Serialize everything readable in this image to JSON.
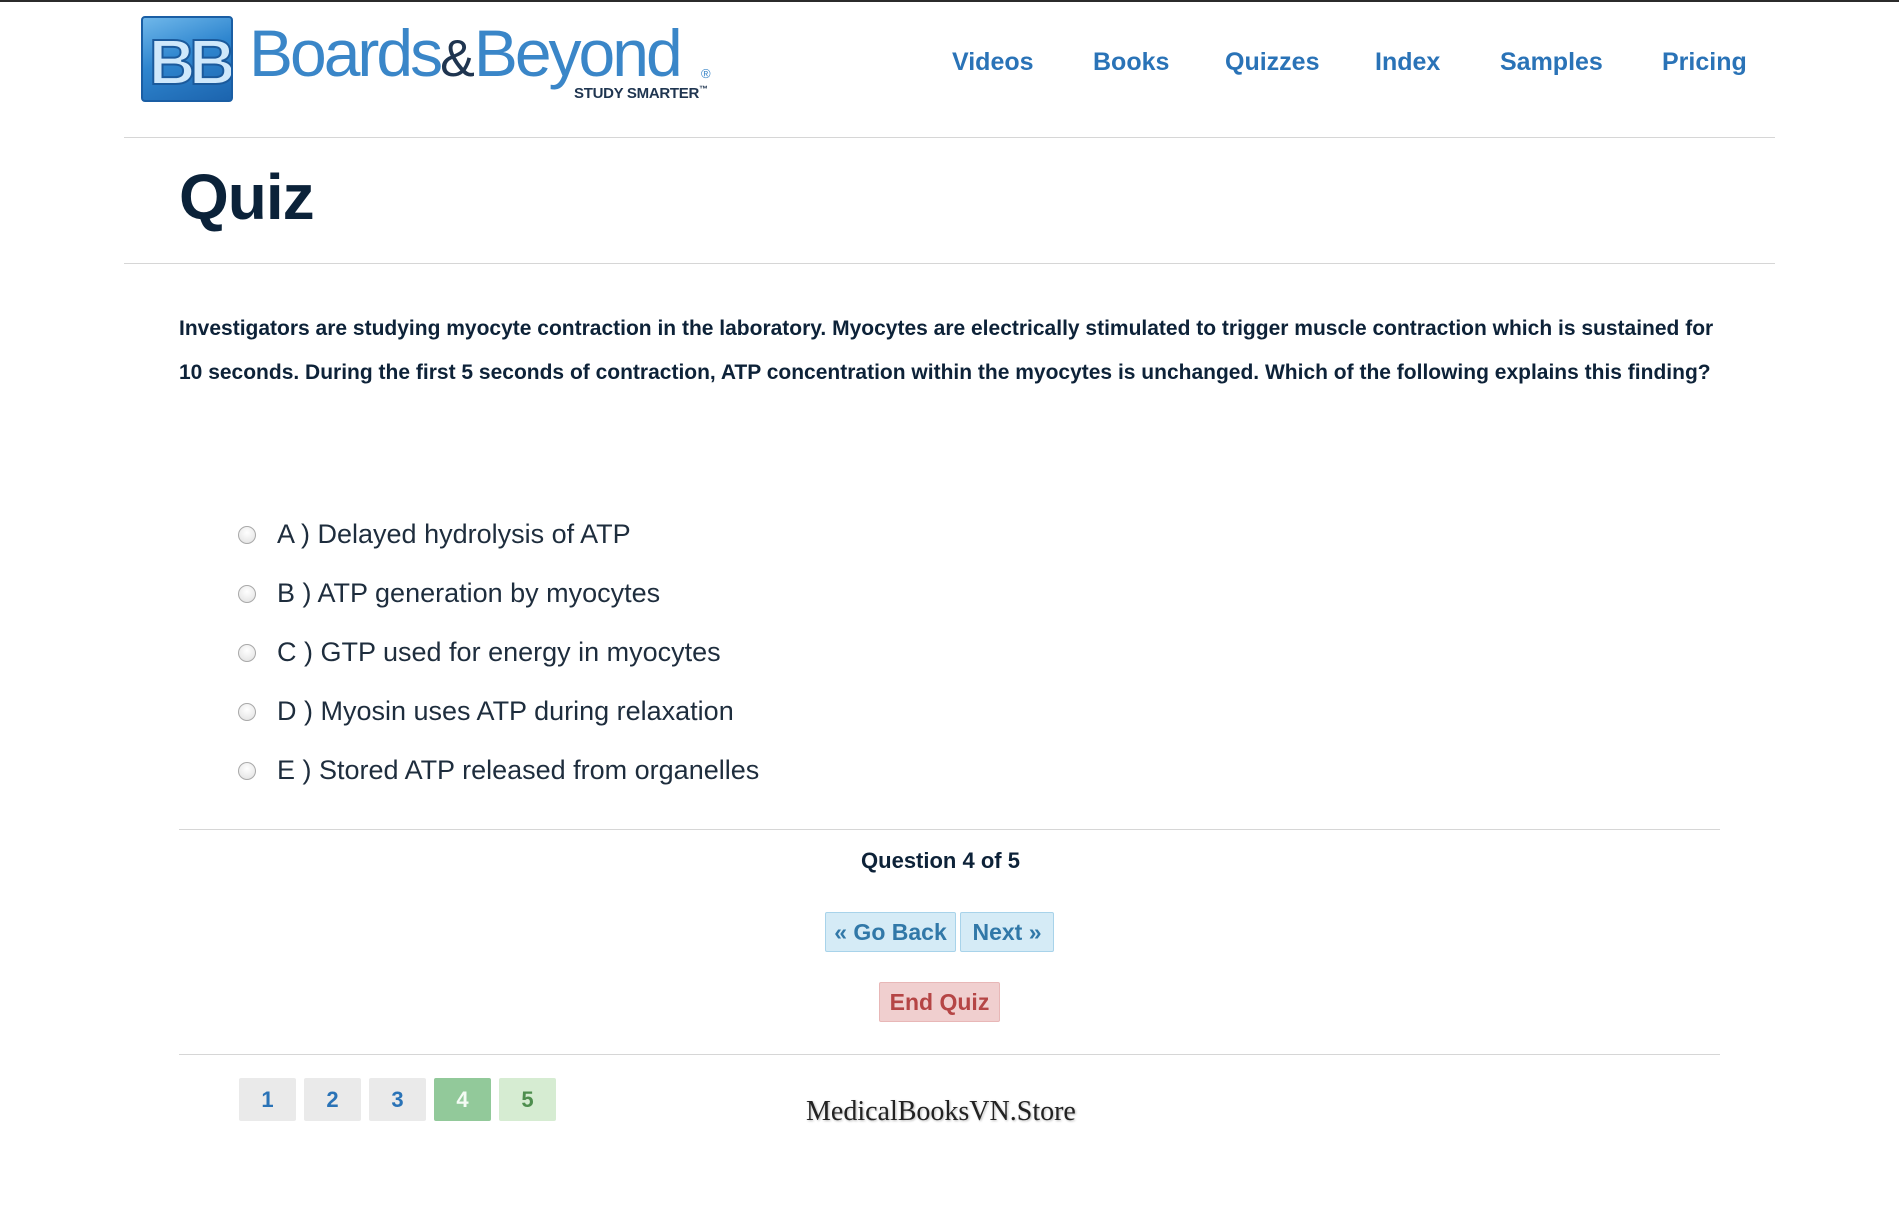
{
  "brand": {
    "mark_text": "BB",
    "word_left": "Boards",
    "word_amp": "&",
    "word_right": "Beyond",
    "registered": "®",
    "tagline": "STUDY SMARTER",
    "tagline_tm": "™",
    "colors": {
      "blue": "#3a86c8",
      "navy": "#1f3550"
    }
  },
  "nav": {
    "items": [
      {
        "label": "Videos"
      },
      {
        "label": "Books"
      },
      {
        "label": "Quizzes"
      },
      {
        "label": "Index"
      },
      {
        "label": "Samples"
      },
      {
        "label": "Pricing"
      }
    ]
  },
  "page": {
    "title": "Quiz"
  },
  "quiz": {
    "question": "Investigators are studying myocyte contraction in the laboratory. Myocytes are electrically stimulated to trigger muscle contraction which is sustained for 10 seconds. During the first 5 seconds of contraction, ATP concentration within the myocytes is unchanged. Which of the following explains this finding?",
    "options": [
      {
        "label": "A ) Delayed hydrolysis of ATP",
        "selected": false
      },
      {
        "label": "B ) ATP generation by myocytes",
        "selected": false
      },
      {
        "label": "C ) GTP used for energy in myocytes",
        "selected": false
      },
      {
        "label": "D ) Myosin uses ATP during relaxation",
        "selected": false
      },
      {
        "label": "E ) Stored ATP released from organelles",
        "selected": false
      }
    ],
    "progress": "Question 4 of 5",
    "buttons": {
      "back": "« Go Back",
      "next": "Next »",
      "end": "End Quiz"
    },
    "pages": [
      "1",
      "2",
      "3",
      "4",
      "5"
    ],
    "current_page": 4
  },
  "watermark": "MedicalBooksVN.Store",
  "colors": {
    "link": "#2a73b7",
    "heading": "#0b2239",
    "current_page": "#92c99a",
    "end_button": "#f0cfcf"
  }
}
